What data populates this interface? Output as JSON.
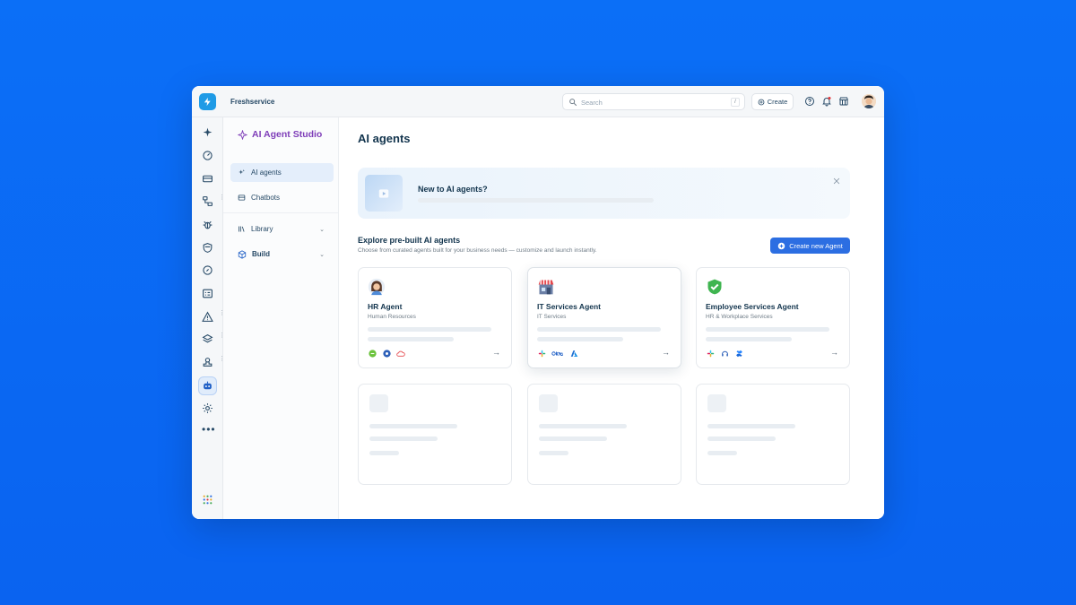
{
  "topbar": {
    "brand": "Freshservice",
    "search_placeholder": "Search",
    "search_shortcut": "/",
    "create_label": "Create"
  },
  "rail": {
    "icons": [
      "sparkle-icon",
      "dashboard-icon",
      "ticket-icon",
      "workflow-icon",
      "bug-icon",
      "shield-icon",
      "compass-icon",
      "checklist-icon",
      "alert-icon",
      "layers-icon",
      "stamp-icon",
      "bot-icon",
      "gear-icon",
      "more-icon",
      "apps-grid-icon"
    ]
  },
  "sidebar": {
    "title": "AI Agent Studio",
    "items": [
      {
        "label": "AI agents",
        "icon": "sparkle-icon",
        "active": true
      },
      {
        "label": "Chatbots",
        "icon": "chatbot-icon",
        "active": false
      },
      {
        "label": "Library",
        "icon": "library-icon",
        "active": false
      },
      {
        "label": "Build",
        "icon": "box-icon",
        "active": false
      }
    ]
  },
  "main": {
    "title": "AI agents",
    "banner": {
      "title": "New to AI agents?"
    },
    "section": {
      "title": "Explore pre-built AI agents",
      "subtitle": "Choose from curated agents built for your business needs — customize and launch instantly.",
      "button": "Create new Agent"
    },
    "cards": [
      {
        "name": "HR Agent",
        "dept": "Human Resources",
        "icon": "hr-avatar-icon",
        "arrow": "→"
      },
      {
        "name": "IT Services Agent",
        "dept": "IT Services",
        "icon": "it-store-icon",
        "arrow": "→"
      },
      {
        "name": "Employee Services Agent",
        "dept": "HR & Workplace Services",
        "icon": "shield-check-icon",
        "arrow": "→"
      }
    ]
  },
  "colors": {
    "background": "#0b6ff7",
    "accent": "#2c6ee2",
    "studio_purple": "#7e3db8"
  }
}
